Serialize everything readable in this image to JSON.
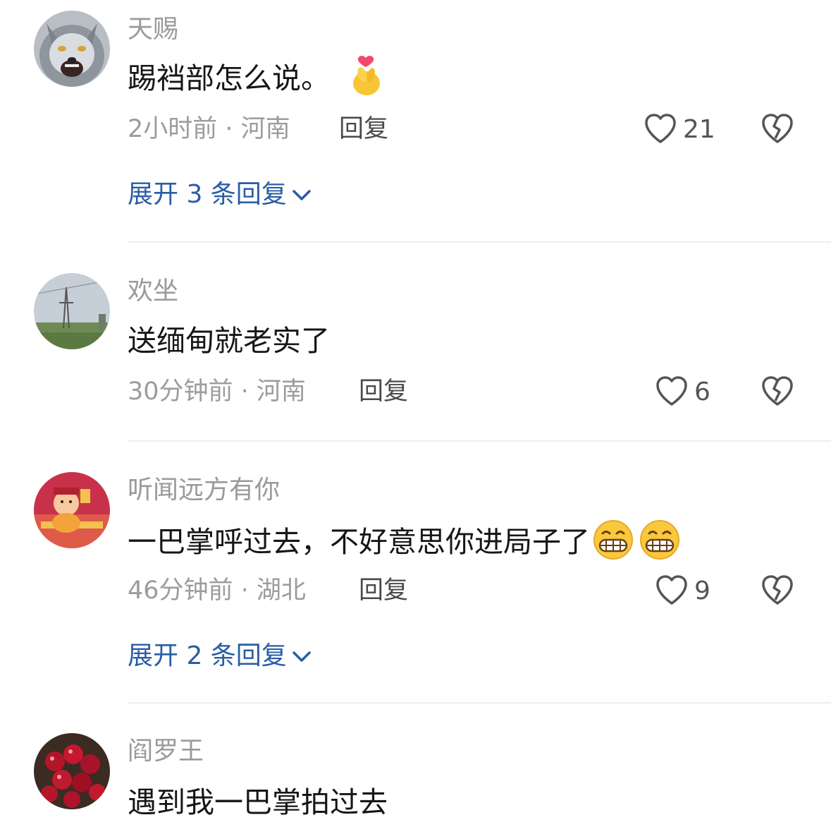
{
  "colors": {
    "username": "#9a9a9a",
    "text": "#161616",
    "meta": "#9c9c9c",
    "reply": "#4a4a4a",
    "expand": "#2a5da6",
    "divider": "#eeeeee"
  },
  "comments": [
    {
      "username": "天赐",
      "text": "踢裆部怎么说。",
      "emoji": "finger-heart-emoji",
      "meta": "2小时前 · 河南",
      "reply_label": "回复",
      "likes": "21",
      "expand": "展开 3 条回复"
    },
    {
      "username": "欢坐",
      "text": "送缅甸就老实了",
      "meta": "30分钟前 · 河南",
      "reply_label": "回复",
      "likes": "6"
    },
    {
      "username": "听闻远方有你",
      "text": "一巴掌呼过去，不好意思你进局子了",
      "emoji": "grin-emoji",
      "meta": "46分钟前 · 湖北",
      "reply_label": "回复",
      "likes": "9",
      "expand": "展开 2 条回复"
    },
    {
      "username": "阎罗王",
      "text": "遇到我一巴掌拍过去"
    }
  ]
}
